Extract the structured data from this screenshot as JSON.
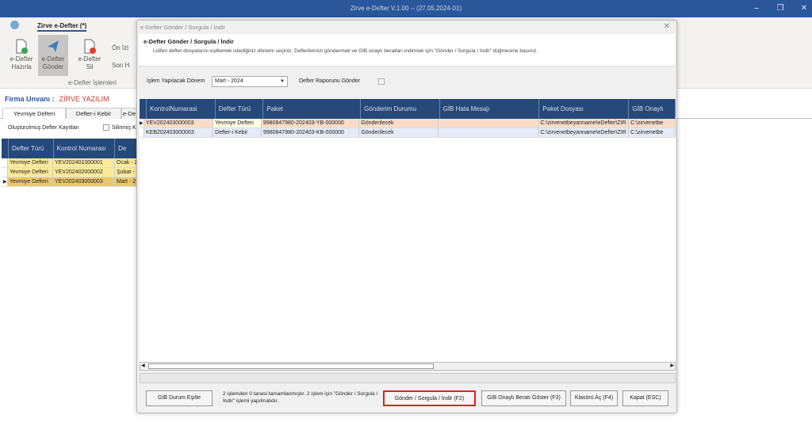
{
  "app": {
    "title": "Zirve e-Defter V.1.00  -- (27.05.2024-01)",
    "tab": "Zirve e-Defter (*)"
  },
  "ribbon": {
    "buttons": [
      {
        "line1": "e-Defter",
        "line2": "Hazırla"
      },
      {
        "line1": "e-Defter",
        "line2": "Gönder"
      },
      {
        "line1": "e-Defter",
        "line2": "Sil"
      }
    ],
    "small": [
      "Ön İzl",
      "Son H"
    ],
    "group_label": "e-Defter İşlemleri"
  },
  "firma": {
    "label": "Firma Unvanı :",
    "value": "ZİRVE YAZILIM"
  },
  "left": {
    "tabs": [
      "Yevmiye Defteri",
      "Defter-i Kebir",
      "e-De"
    ],
    "section_label": "Oluşturulmuş Defter Kayıtları",
    "deleted_label": "Silinmiş Ka",
    "columns": [
      "Defter Türü",
      "Kontrol Numarası",
      "De"
    ],
    "rows": [
      [
        "Yevmiye Defteri",
        "YEV202401000001",
        "Ocak - 2"
      ],
      [
        "Yevmiye Defteri",
        "YEV202402000002",
        "Şubat -"
      ],
      [
        "Yevmiye Defteri",
        "YEV202403000003",
        "Mart - 2"
      ]
    ]
  },
  "dialog": {
    "window_title": "e-Defter Gönder / Sorgula / İndir",
    "heading": "e-Defter Gönder / Sorgula / İndir",
    "description": "Lütfen defter dosyalarını eşitlemek istediğiniz dönemi seçiniz. Defterlerinizi göndermek ve GİB onaylı beratları indirmek için \"Gönder / Sorgula / İndir\" düğmesine basınız.",
    "period_label": "İşlem Yapılacak Dönem",
    "period_value": "Mart - 2024",
    "report_label": "Defter Raporunu Gönder",
    "report_checked": false,
    "columns": [
      "KontrolNumarasi",
      "Defter Türü",
      "Paket",
      "Gönderim Durumu",
      "GİB Hata Mesajı",
      "Paket Dosyası",
      "GİB Onaylı"
    ],
    "rows": [
      [
        "YEV202403000003",
        "Yevmiye Defteri",
        "9980847980-202403-YB-000000",
        "Gönderilecek",
        "",
        "C:\\zirvenetbeyanname\\eDefter\\ZIR",
        "C:\\zirvenetbe"
      ],
      [
        "KEB202403000003",
        "Defter-i Kebir",
        "9980847980-202403-KB-000000",
        "Gönderilecek",
        "",
        "C:\\zirvenetbeyanname\\eDefter\\ZIR",
        "C:\\zirvenetbe"
      ]
    ],
    "status_text": "2 işlemden 0 tanesi tamamlanmıştır. 2 işlem için \"Gönder / Sorgula / İndir\" işlemi yapılmalıdır.",
    "buttons": {
      "sync": "GİB Durum Eşitle",
      "send": "Gönder / Sorgula / İndir (F2)",
      "show": "GİB Onaylı Beratı Göster (F3)",
      "folder": "Klasörü Aç (F4)",
      "close": "Kapat (ESC)"
    }
  },
  "colors": {
    "titlebar": "#2b579a",
    "grid_header": "#24497a",
    "highlight": "#e02020"
  }
}
